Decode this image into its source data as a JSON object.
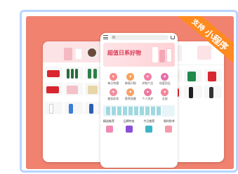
{
  "badge": {
    "line1": "支持",
    "line2": "小程序"
  },
  "center": {
    "search_placeholder": "",
    "banner_title": "超值日系好物",
    "banner_sub": "",
    "features": [
      "",
      "",
      ""
    ],
    "categories": [
      {
        "label": "每日特惠",
        "color": "#f58a8a",
        "icon": "gift-icon"
      },
      {
        "label": "跨境闪购",
        "color": "#f7a35c",
        "icon": "bolt-icon"
      },
      {
        "label": "护肤产品",
        "color": "#f27fa6",
        "icon": "bottle-icon"
      },
      {
        "label": "母婴用品",
        "color": "#e86fa9",
        "icon": "baby-icon"
      },
      {
        "label": "美妆彩妆",
        "color": "#f08f9f",
        "icon": "lipstick-icon"
      },
      {
        "label": "营养保健",
        "color": "#f5a36b",
        "icon": "pill-icon"
      },
      {
        "label": "个人洗护",
        "color": "#ea7aa0",
        "icon": "soap-icon"
      },
      {
        "label": "全部",
        "color": "#f2889a",
        "icon": "grid-icon"
      }
    ],
    "tabs": [
      "精选推荐",
      "品牌特卖",
      "今日推荐",
      "限时秒杀"
    ]
  },
  "left": {
    "header_label": "",
    "section1": "",
    "section2": "",
    "prices": [
      "",
      "",
      "",
      "",
      "",
      ""
    ]
  },
  "right": {
    "tabs": [
      "",
      "",
      ""
    ],
    "prices": [
      "",
      "",
      "",
      "",
      "",
      ""
    ]
  },
  "colors": {
    "background": "#f0826f",
    "frame_border": "#b9d4ff",
    "badge": "#ff8a1f",
    "accent": "#e84a5f"
  }
}
